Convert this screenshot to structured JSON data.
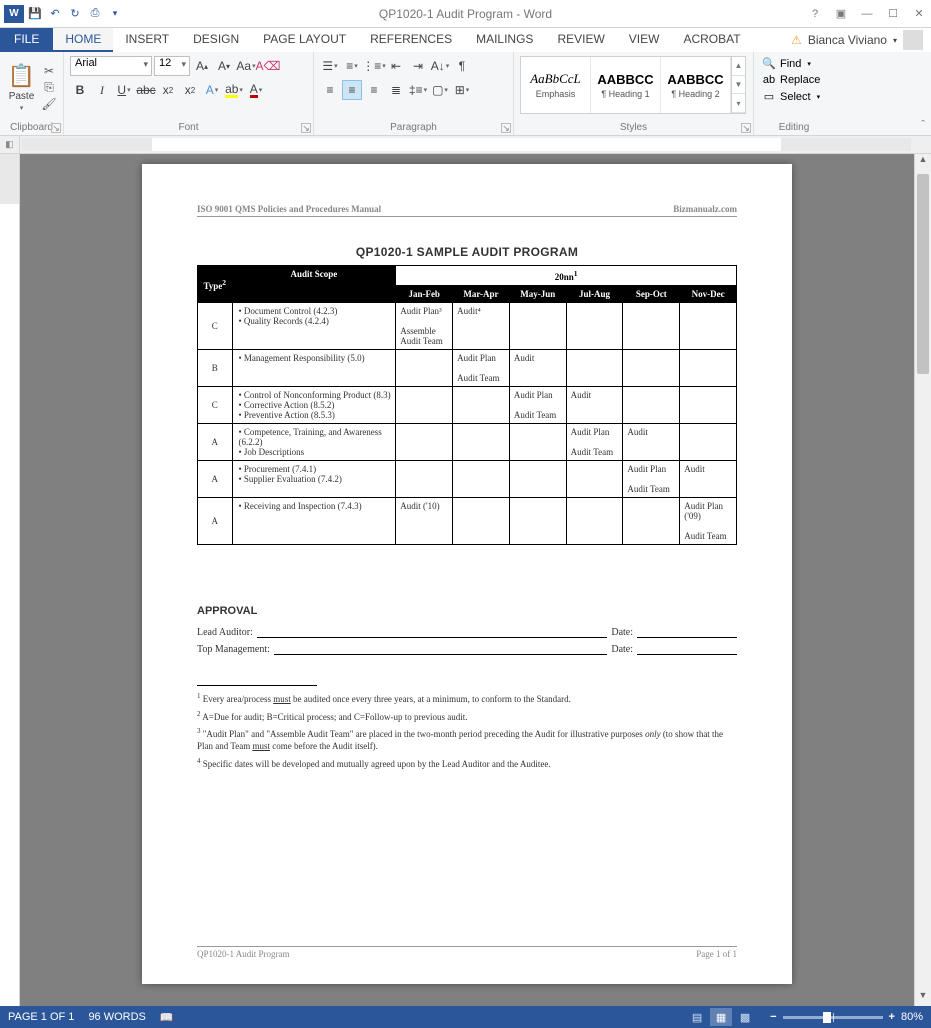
{
  "titlebar": {
    "title": "QP1020-1 Audit Program - Word"
  },
  "tabs": {
    "file": "FILE",
    "home": "HOME",
    "insert": "INSERT",
    "design": "DESIGN",
    "layout": "PAGE LAYOUT",
    "references": "REFERENCES",
    "mailings": "MAILINGS",
    "review": "REVIEW",
    "view": "VIEW",
    "acrobat": "ACROBAT"
  },
  "user": {
    "name": "Bianca Viviano"
  },
  "ribbon": {
    "clipboard": {
      "label": "Clipboard",
      "paste": "Paste"
    },
    "font": {
      "label": "Font",
      "name": "Arial",
      "size": "12"
    },
    "paragraph": {
      "label": "Paragraph"
    },
    "styles": {
      "label": "Styles",
      "items": [
        {
          "preview": "AaBbCcL",
          "name": "Emphasis",
          "style": "font-style:italic; font-family:serif;"
        },
        {
          "preview": "AABBCC",
          "name": "¶ Heading 1",
          "style": "font-weight:bold; font-family:Arial;"
        },
        {
          "preview": "AABBCC",
          "name": "¶ Heading 2",
          "style": "font-weight:bold; font-family:Arial;"
        }
      ]
    },
    "editing": {
      "label": "Editing",
      "find": "Find",
      "replace": "Replace",
      "select": "Select"
    }
  },
  "document": {
    "header_left": "ISO 9001 QMS Policies and Procedures Manual",
    "header_right": "Bizmanualz.com",
    "title": "QP1020-1 SAMPLE AUDIT PROGRAM",
    "year": "20nn",
    "year_sup": "1",
    "col_type": "Type",
    "col_type_sup": "2",
    "col_scope": "Audit Scope",
    "periods": [
      "Jan-Feb",
      "Mar-Apr",
      "May-Jun",
      "Jul-Aug",
      "Sep-Oct",
      "Nov-Dec"
    ],
    "rows": [
      {
        "type": "C",
        "scope": [
          "Document Control (4.2.3)",
          "Quality Records (4.2.4)"
        ],
        "cells": [
          "Audit Plan³\nAssemble Audit Team",
          "Audit⁴",
          "",
          "",
          "",
          ""
        ]
      },
      {
        "type": "B",
        "scope": [
          "Management Responsibility (5.0)"
        ],
        "cells": [
          "",
          "Audit Plan\nAudit Team",
          "Audit",
          "",
          "",
          ""
        ]
      },
      {
        "type": "C",
        "scope": [
          "Control of Nonconforming Product (8.3)",
          "Corrective Action (8.5.2)",
          "Preventive Action (8.5.3)"
        ],
        "cells": [
          "",
          "",
          "Audit Plan\nAudit Team",
          "Audit",
          "",
          ""
        ]
      },
      {
        "type": "A",
        "scope": [
          "Competence, Training, and Awareness (6.2.2)",
          "Job Descriptions"
        ],
        "cells": [
          "",
          "",
          "",
          "Audit Plan\nAudit Team",
          "Audit",
          ""
        ]
      },
      {
        "type": "A",
        "scope": [
          "Procurement (7.4.1)",
          "Supplier Evaluation (7.4.2)"
        ],
        "cells": [
          "",
          "",
          "",
          "",
          "Audit Plan\nAudit Team",
          "Audit"
        ]
      },
      {
        "type": "A",
        "scope": [
          "Receiving and Inspection (7.4.3)"
        ],
        "cells": [
          "Audit ('10)",
          "",
          "",
          "",
          "",
          "Audit Plan ('09)\nAudit Team"
        ]
      }
    ],
    "approval": {
      "heading": "APPROVAL",
      "lead": "Lead Auditor:",
      "top": "Top Management:",
      "date": "Date:"
    },
    "footnotes": [
      "Every area/process must be audited once every three years, at a minimum, to conform to the Standard.",
      "A=Due for audit; B=Critical process; and C=Follow-up to previous audit.",
      "\"Audit Plan\" and \"Assemble Audit Team\" are placed in the two-month period preceding the Audit for illustrative purposes only (to show that the Plan and Team must come before the Audit itself).",
      "Specific dates will be developed and mutually agreed upon by the Lead Auditor and the Auditee."
    ],
    "footer_left": "QP1020-1 Audit Program",
    "footer_right": "Page 1 of 1"
  },
  "statusbar": {
    "page": "PAGE 1 OF 1",
    "words": "96 WORDS",
    "zoom": "80%"
  }
}
